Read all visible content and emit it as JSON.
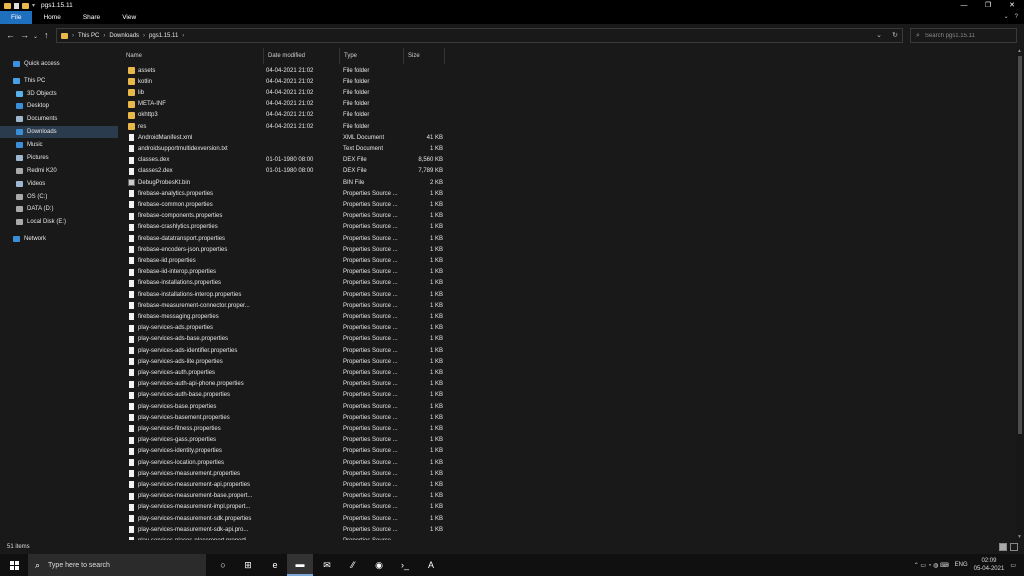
{
  "window": {
    "title": "pgs1.15.11",
    "controls": [
      "—",
      "❐",
      "✕"
    ]
  },
  "ribbon": {
    "tabs": [
      "File",
      "Home",
      "Share",
      "View"
    ],
    "active_tab": "File",
    "help": "?"
  },
  "address": {
    "crumbs": [
      "This PC",
      "Downloads",
      "pgs1.15.11"
    ],
    "search_placeholder": "Search pgs1.15.11"
  },
  "nav": {
    "items": [
      {
        "label": "Quick access",
        "icon": "star-icon",
        "indent": 0,
        "color": "#3b8fe0"
      },
      {
        "label": "This PC",
        "icon": "computer-icon",
        "indent": 0,
        "color": "#4aa0e6"
      },
      {
        "label": "3D Objects",
        "icon": "cube-icon",
        "indent": 1,
        "color": "#5ab0e8"
      },
      {
        "label": "Desktop",
        "icon": "desktop-icon",
        "indent": 1,
        "color": "#3a8fd8"
      },
      {
        "label": "Documents",
        "icon": "documents-icon",
        "indent": 1,
        "color": "#9fb8cf"
      },
      {
        "label": "Downloads",
        "icon": "download-icon",
        "indent": 1,
        "color": "#3a8fd8",
        "selected": true
      },
      {
        "label": "Music",
        "icon": "music-icon",
        "indent": 1,
        "color": "#3a8fd8"
      },
      {
        "label": "Pictures",
        "icon": "pictures-icon",
        "indent": 1,
        "color": "#9fb8cf"
      },
      {
        "label": "Redmi K20",
        "icon": "phone-icon",
        "indent": 1,
        "color": "#aaaaaa"
      },
      {
        "label": "Videos",
        "icon": "videos-icon",
        "indent": 1,
        "color": "#9fb8cf"
      },
      {
        "label": "OS (C:)",
        "icon": "drive-icon",
        "indent": 1,
        "color": "#aaaaaa"
      },
      {
        "label": "DATA (D:)",
        "icon": "drive-icon",
        "indent": 1,
        "color": "#aaaaaa"
      },
      {
        "label": "Local Disk (E:)",
        "icon": "drive-icon",
        "indent": 1,
        "color": "#aaaaaa"
      },
      {
        "label": "Network",
        "icon": "network-icon",
        "indent": 0,
        "color": "#3a8fd8"
      }
    ]
  },
  "columns": {
    "name": "Name",
    "date": "Date modified",
    "type": "Type",
    "size": "Size"
  },
  "files": [
    {
      "name": "assets",
      "date": "04-04-2021 21:02",
      "type": "File folder",
      "size": "",
      "kind": "folder"
    },
    {
      "name": "kotlin",
      "date": "04-04-2021 21:02",
      "type": "File folder",
      "size": "",
      "kind": "folder"
    },
    {
      "name": "lib",
      "date": "04-04-2021 21:02",
      "type": "File folder",
      "size": "",
      "kind": "folder"
    },
    {
      "name": "META-INF",
      "date": "04-04-2021 21:02",
      "type": "File folder",
      "size": "",
      "kind": "folder"
    },
    {
      "name": "okhttp3",
      "date": "04-04-2021 21:02",
      "type": "File folder",
      "size": "",
      "kind": "folder"
    },
    {
      "name": "res",
      "date": "04-04-2021 21:02",
      "type": "File folder",
      "size": "",
      "kind": "folder"
    },
    {
      "name": "AndroidManifest.xml",
      "date": "",
      "type": "XML Document",
      "size": "41 KB",
      "kind": "file"
    },
    {
      "name": "androidsupportmultidexversion.txt",
      "date": "",
      "type": "Text Document",
      "size": "1 KB",
      "kind": "file"
    },
    {
      "name": "classes.dex",
      "date": "01-01-1980 08:00",
      "type": "DEX File",
      "size": "8,560 KB",
      "kind": "file"
    },
    {
      "name": "classes2.dex",
      "date": "01-01-1980 08:00",
      "type": "DEX File",
      "size": "7,789 KB",
      "kind": "file"
    },
    {
      "name": "DebugProbesKt.bin",
      "date": "",
      "type": "BIN File",
      "size": "2 KB",
      "kind": "bin"
    },
    {
      "name": "firebase-analytics.properties",
      "date": "",
      "type": "Properties Source ...",
      "size": "1 KB",
      "kind": "file"
    },
    {
      "name": "firebase-common.properties",
      "date": "",
      "type": "Properties Source ...",
      "size": "1 KB",
      "kind": "file"
    },
    {
      "name": "firebase-components.properties",
      "date": "",
      "type": "Properties Source ...",
      "size": "1 KB",
      "kind": "file"
    },
    {
      "name": "firebase-crashlytics.properties",
      "date": "",
      "type": "Properties Source ...",
      "size": "1 KB",
      "kind": "file"
    },
    {
      "name": "firebase-datatransport.properties",
      "date": "",
      "type": "Properties Source ...",
      "size": "1 KB",
      "kind": "file"
    },
    {
      "name": "firebase-encoders-json.properties",
      "date": "",
      "type": "Properties Source ...",
      "size": "1 KB",
      "kind": "file"
    },
    {
      "name": "firebase-iid.properties",
      "date": "",
      "type": "Properties Source ...",
      "size": "1 KB",
      "kind": "file"
    },
    {
      "name": "firebase-iid-interop.properties",
      "date": "",
      "type": "Properties Source ...",
      "size": "1 KB",
      "kind": "file"
    },
    {
      "name": "firebase-installations.properties",
      "date": "",
      "type": "Properties Source ...",
      "size": "1 KB",
      "kind": "file"
    },
    {
      "name": "firebase-installations-interop.properties",
      "date": "",
      "type": "Properties Source ...",
      "size": "1 KB",
      "kind": "file"
    },
    {
      "name": "firebase-measurement-connector.proper...",
      "date": "",
      "type": "Properties Source ...",
      "size": "1 KB",
      "kind": "file"
    },
    {
      "name": "firebase-messaging.properties",
      "date": "",
      "type": "Properties Source ...",
      "size": "1 KB",
      "kind": "file"
    },
    {
      "name": "play-services-ads.properties",
      "date": "",
      "type": "Properties Source ...",
      "size": "1 KB",
      "kind": "file"
    },
    {
      "name": "play-services-ads-base.properties",
      "date": "",
      "type": "Properties Source ...",
      "size": "1 KB",
      "kind": "file"
    },
    {
      "name": "play-services-ads-identifier.properties",
      "date": "",
      "type": "Properties Source ...",
      "size": "1 KB",
      "kind": "file"
    },
    {
      "name": "play-services-ads-lite.properties",
      "date": "",
      "type": "Properties Source ...",
      "size": "1 KB",
      "kind": "file"
    },
    {
      "name": "play-services-auth.properties",
      "date": "",
      "type": "Properties Source ...",
      "size": "1 KB",
      "kind": "file"
    },
    {
      "name": "play-services-auth-api-phone.properties",
      "date": "",
      "type": "Properties Source ...",
      "size": "1 KB",
      "kind": "file"
    },
    {
      "name": "play-services-auth-base.properties",
      "date": "",
      "type": "Properties Source ...",
      "size": "1 KB",
      "kind": "file"
    },
    {
      "name": "play-services-base.properties",
      "date": "",
      "type": "Properties Source ...",
      "size": "1 KB",
      "kind": "file"
    },
    {
      "name": "play-services-basement.properties",
      "date": "",
      "type": "Properties Source ...",
      "size": "1 KB",
      "kind": "file"
    },
    {
      "name": "play-services-fitness.properties",
      "date": "",
      "type": "Properties Source ...",
      "size": "1 KB",
      "kind": "file"
    },
    {
      "name": "play-services-gass.properties",
      "date": "",
      "type": "Properties Source ...",
      "size": "1 KB",
      "kind": "file"
    },
    {
      "name": "play-services-identity.properties",
      "date": "",
      "type": "Properties Source ...",
      "size": "1 KB",
      "kind": "file"
    },
    {
      "name": "play-services-location.properties",
      "date": "",
      "type": "Properties Source ...",
      "size": "1 KB",
      "kind": "file"
    },
    {
      "name": "play-services-measurement.properties",
      "date": "",
      "type": "Properties Source ...",
      "size": "1 KB",
      "kind": "file"
    },
    {
      "name": "play-services-measurement-api.properties",
      "date": "",
      "type": "Properties Source ...",
      "size": "1 KB",
      "kind": "file"
    },
    {
      "name": "play-services-measurement-base.propert...",
      "date": "",
      "type": "Properties Source ...",
      "size": "1 KB",
      "kind": "file"
    },
    {
      "name": "play-services-measurement-impl.propert...",
      "date": "",
      "type": "Properties Source ...",
      "size": "1 KB",
      "kind": "file"
    },
    {
      "name": "play-services-measurement-sdk.properties",
      "date": "",
      "type": "Properties Source ...",
      "size": "1 KB",
      "kind": "file"
    },
    {
      "name": "play-services-measurement-sdk-api.pro...",
      "date": "",
      "type": "Properties Source ...",
      "size": "1 KB",
      "kind": "file"
    },
    {
      "name": "play-services-places-placereport.properti...",
      "date": "",
      "type": "Properties Source ...",
      "size": "",
      "kind": "file"
    }
  ],
  "status": {
    "count": "51 items"
  },
  "taskbar": {
    "search_text": "Type here to search",
    "apps": [
      {
        "icon": "task-view-icon",
        "glyph": "○"
      },
      {
        "icon": "timeline-icon",
        "glyph": "⊞"
      },
      {
        "icon": "edge-icon",
        "glyph": "e"
      },
      {
        "icon": "file-explorer-icon",
        "glyph": "▬",
        "active": true
      },
      {
        "icon": "mail-icon",
        "glyph": "✉"
      },
      {
        "icon": "app-icon",
        "glyph": "⁄⁄"
      },
      {
        "icon": "firefox-icon",
        "glyph": "◉"
      },
      {
        "icon": "terminal-icon",
        "glyph": "›_"
      },
      {
        "icon": "ae-app-icon",
        "glyph": "A"
      }
    ],
    "lang": "ENG",
    "time": "02:09",
    "date": "05-04-2021",
    "tray_glyphs": "⌃ ▭ ◔ ◍ ⌨"
  }
}
